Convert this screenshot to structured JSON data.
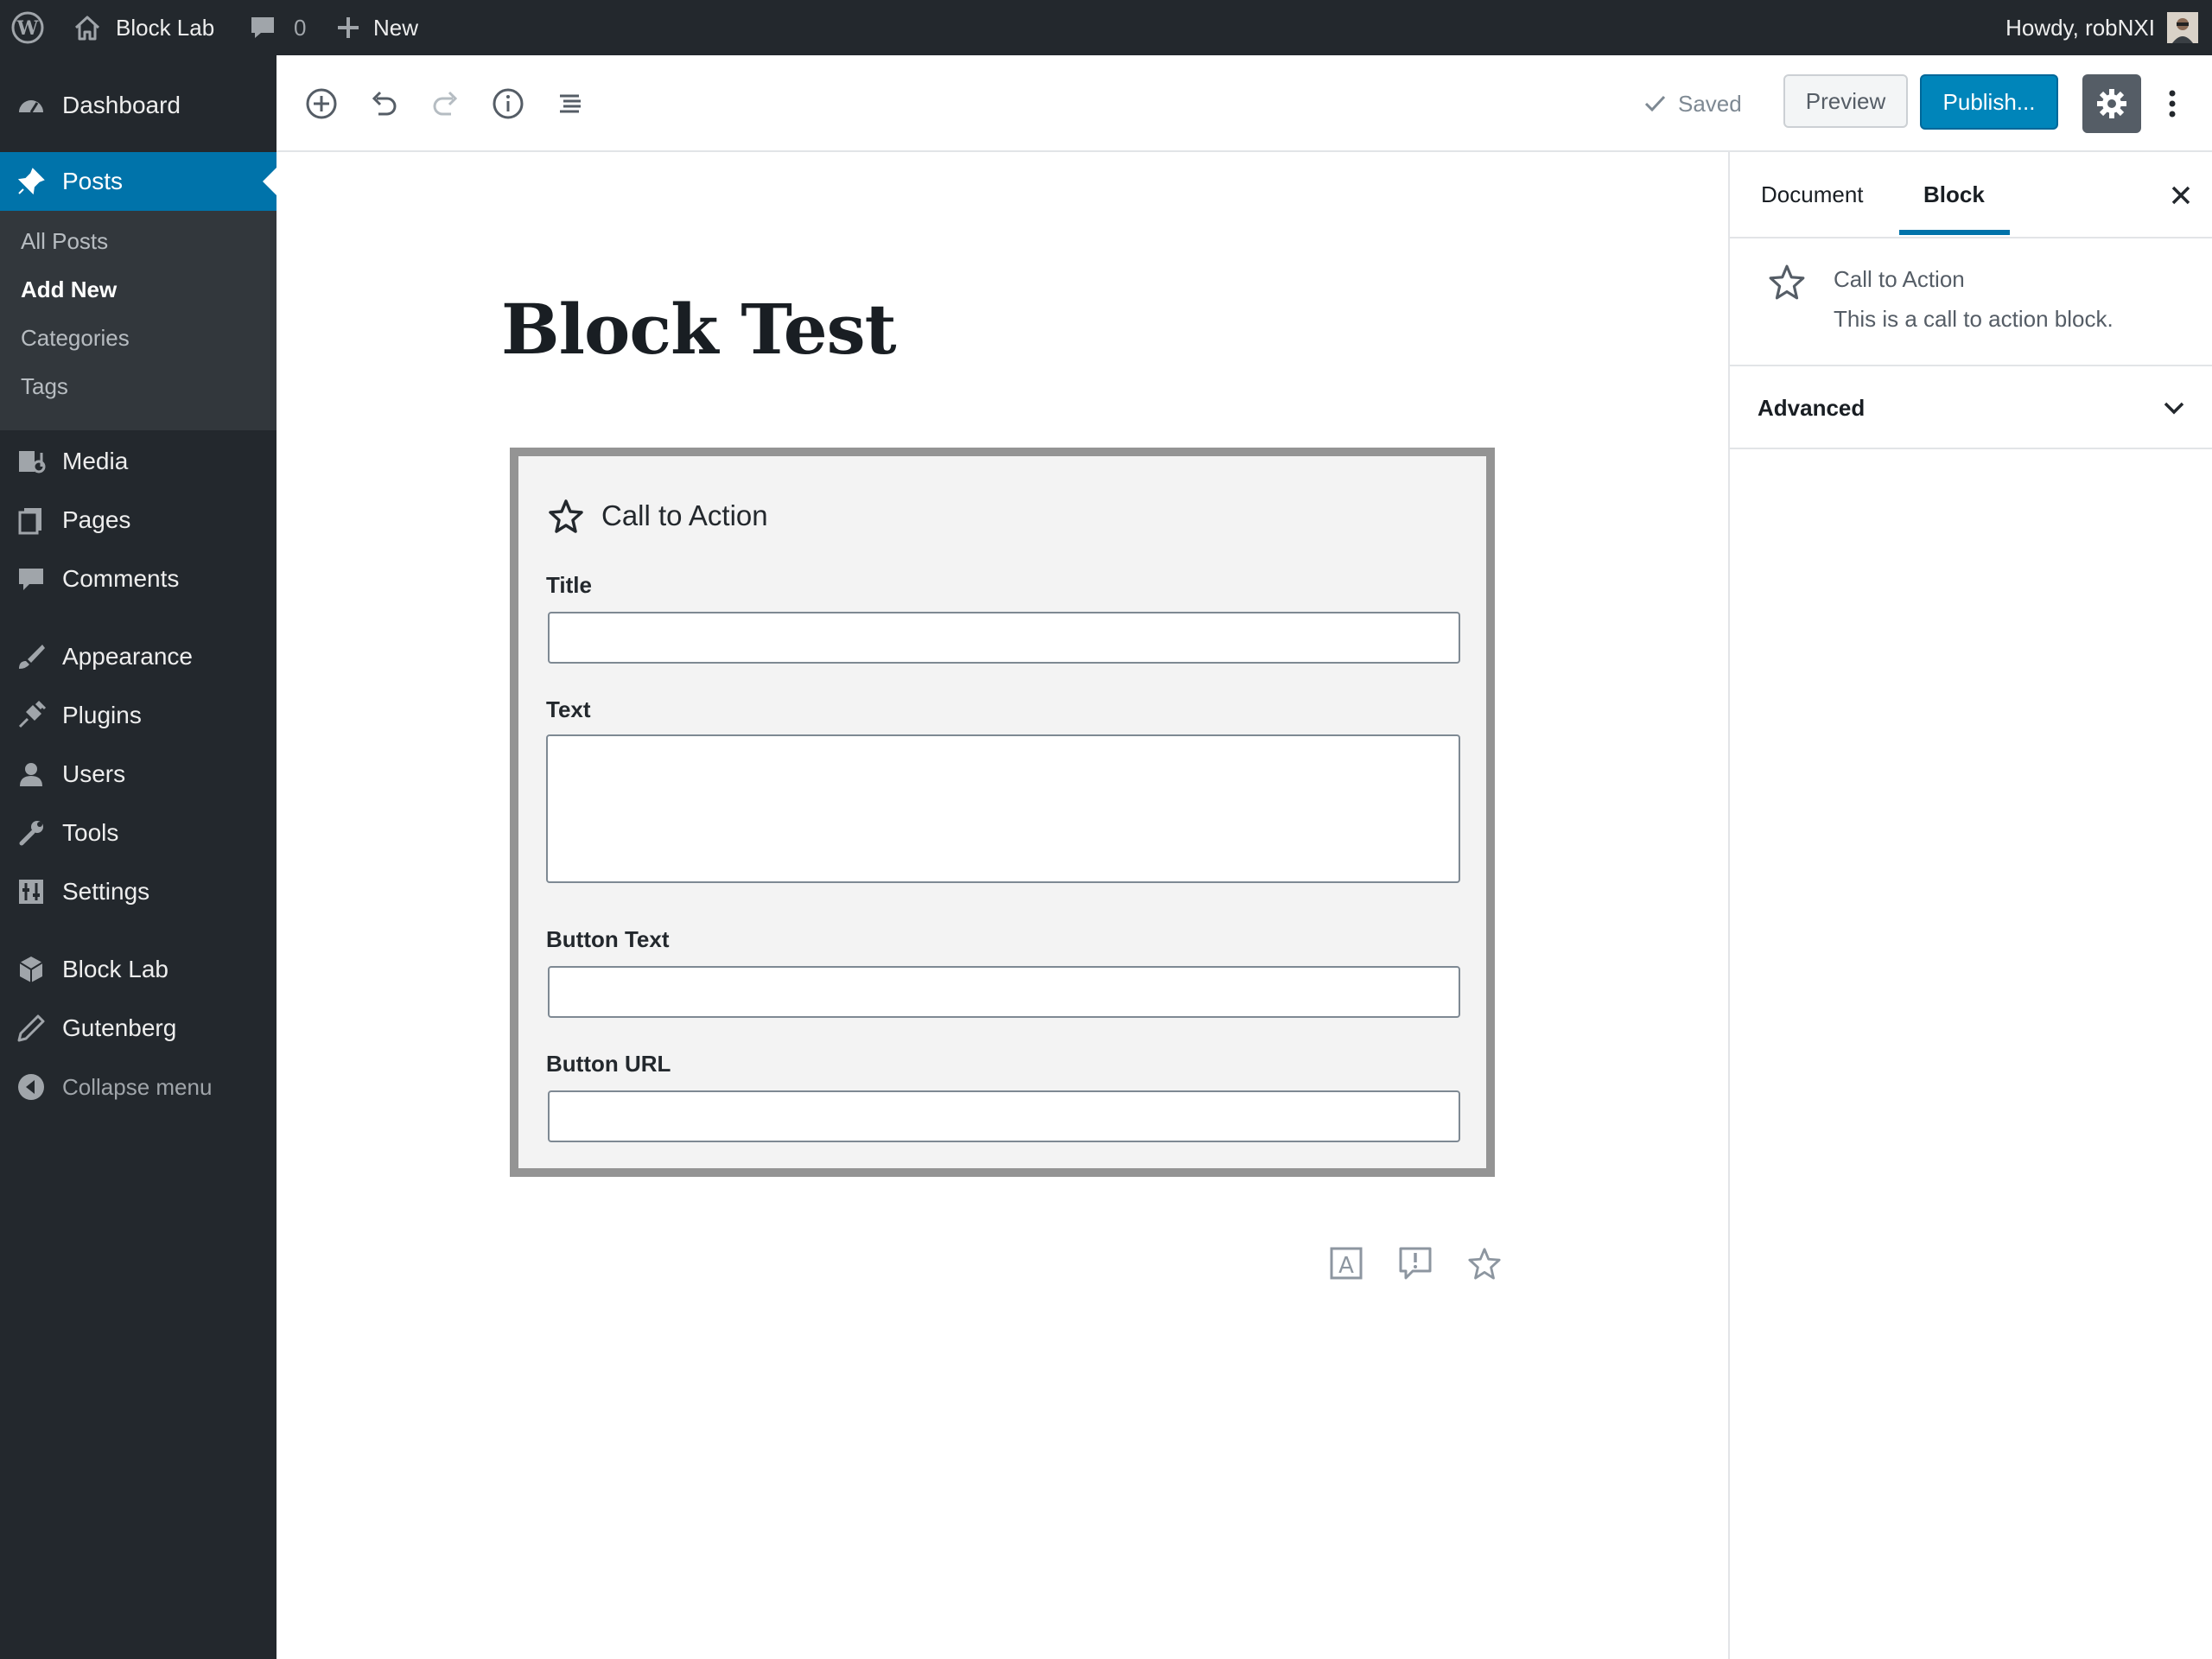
{
  "colors": {
    "admin_bar_bg": "#23282d",
    "sidebar_bg": "#23282d",
    "submenu_bg": "#32373c",
    "accent": "#0073aa",
    "publish_bg": "#0085ba",
    "block_border": "#949494",
    "block_bg": "#f3f3f3"
  },
  "admin_bar": {
    "site_name": "Block Lab",
    "comments_count": "0",
    "new_label": "New",
    "greeting": "Howdy, robNXI"
  },
  "sidebar": {
    "dashboard": "Dashboard",
    "posts": "Posts",
    "posts_submenu": [
      "All Posts",
      "Add New",
      "Categories",
      "Tags"
    ],
    "media": "Media",
    "pages": "Pages",
    "comments": "Comments",
    "appearance": "Appearance",
    "plugins": "Plugins",
    "users": "Users",
    "tools": "Tools",
    "settings": "Settings",
    "block_lab": "Block Lab",
    "gutenberg": "Gutenberg",
    "collapse": "Collapse menu"
  },
  "toolbar": {
    "saved_label": "Saved",
    "preview_label": "Preview",
    "publish_label": "Publish..."
  },
  "editor": {
    "post_title": "Block Test",
    "block": {
      "name": "Call to Action",
      "fields": [
        "Title",
        "Text",
        "Button Text",
        "Button URL"
      ]
    }
  },
  "panel": {
    "tab_document": "Document",
    "tab_block": "Block",
    "block_name": "Call to Action",
    "block_description": "This is a call to action block.",
    "advanced_label": "Advanced"
  }
}
